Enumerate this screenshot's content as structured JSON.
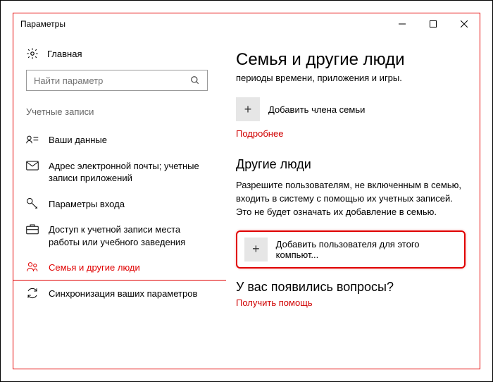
{
  "window": {
    "title": "Параметры"
  },
  "sidebar": {
    "home": "Главная",
    "search_placeholder": "Найти параметр",
    "section": "Учетные записи",
    "items": [
      {
        "label": "Ваши данные"
      },
      {
        "label": "Адрес электронной почты; учетные записи приложений"
      },
      {
        "label": "Параметры входа"
      },
      {
        "label": "Доступ к учетной записи места работы или учебного заведения"
      },
      {
        "label": "Семья и другие люди"
      },
      {
        "label": "Синхронизация ваших параметров"
      }
    ]
  },
  "main": {
    "heading": "Семья и другие люди",
    "subtitle": "периоды времени, приложения и игры.",
    "add_family": "Добавить члена семьи",
    "more": "Подробнее",
    "others_heading": "Другие люди",
    "others_desc": "Разрешите пользователям, не включенным в семью, входить в систему с помощью их учетных записей. Это не будет означать их добавление в семью.",
    "add_user": "Добавить пользователя для этого компьют...",
    "questions": "У вас появились вопросы?",
    "help": "Получить помощь"
  }
}
